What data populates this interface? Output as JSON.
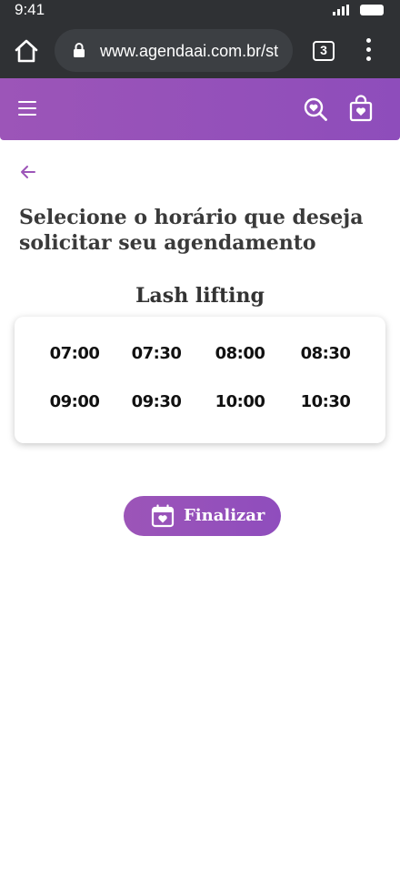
{
  "status_bar": {
    "time": "9:41"
  },
  "browser": {
    "url": "www.agendaai.com.br/st",
    "tab_count": "3"
  },
  "colors": {
    "brand_purple": "#9c55b8",
    "browser_chrome": "#2f3134"
  },
  "header": {
    "menu_icon": "hamburger-icon",
    "search_icon": "search-heart-icon",
    "bag_icon": "shopping-bag-heart-icon"
  },
  "page": {
    "back_icon": "arrow-left-icon",
    "title": "Selecione o horário que deseja solicitar seu agendamento",
    "service_name": "Lash lifting"
  },
  "time_slots": [
    "07:00",
    "07:30",
    "08:00",
    "08:30",
    "09:00",
    "09:30",
    "10:00",
    "10:30"
  ],
  "actions": {
    "finalize_label": "Finalizar",
    "finalize_icon": "calendar-heart-icon"
  }
}
